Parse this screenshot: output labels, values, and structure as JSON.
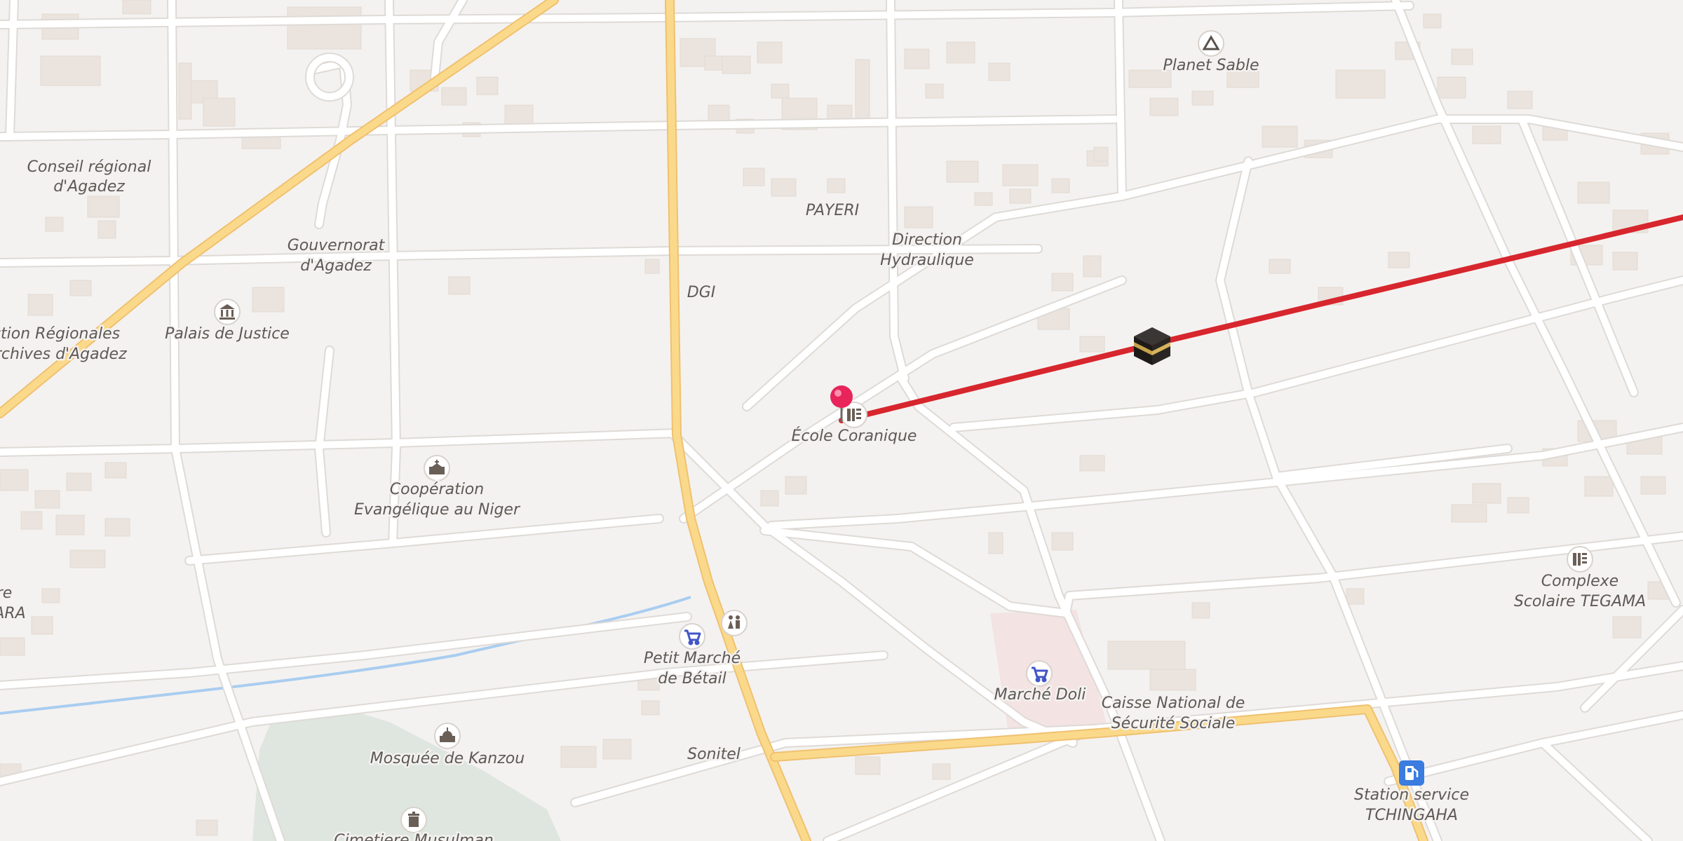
{
  "map": {
    "labels": {
      "planet_sable": "Planet Sable",
      "conseil_l1": "Conseil régional",
      "conseil_l2": "d'Agadez",
      "payeri": "PAYERI",
      "direction_l1": "Direction",
      "direction_l2": "Hydraulique",
      "gouvernorat_l1": "Gouvernorat",
      "gouvernorat_l2": "d'Agadez",
      "dgi": "DGI",
      "archives_l1": "ction Régionales",
      "archives_l2": "archives d'Agadez",
      "palais": "Palais de Justice",
      "ecole": "École Coranique",
      "cooperation_l1": "Coopération",
      "cooperation_l2": "Evangélique au Niger",
      "edge_l1": "re",
      "edge_l2": "ARA",
      "complexe_l1": "Complexe",
      "complexe_l2": "Scolaire TEGAMA",
      "petit_marche_l1": "Petit Marché",
      "petit_marche_l2": "de Bétail",
      "marche_doli": "Marché Doli",
      "caisse_l1": "Caisse National de",
      "caisse_l2": "Sécurité Sociale",
      "sonitel": "Sonitel",
      "mosquee": "Mosquée de Kanzou",
      "station_l1": "Station service",
      "station_l2": "TCHINGAHA",
      "cimetiere": "Cimetiere Musulman"
    },
    "icons": {
      "planet_sable": "triangle-icon",
      "palais": "courthouse-icon",
      "ecole": "school-icon",
      "cooperation": "church-icon",
      "complexe": "school-icon",
      "petit_marche": "shopping-cart-icon",
      "toilets": "toilets-icon",
      "marche_doli": "shopping-cart-icon",
      "mosquee": "mosque-icon",
      "cimetiere": "cemetery-icon",
      "station": "fuel-icon",
      "kaaba": "kaaba-icon",
      "pin": "location-pin-icon"
    },
    "colors": {
      "background": "#f4f2f0",
      "road": "#ffffff",
      "main_road": "#fbd98b",
      "route_line": "#d7262d",
      "water": "#a9cdf0",
      "park": "#dfe6df",
      "pin": "#e8245a",
      "poi_icon": "#6a5f57",
      "shop_icon": "#4256c8",
      "fuel_icon": "#3a7ce0"
    }
  }
}
